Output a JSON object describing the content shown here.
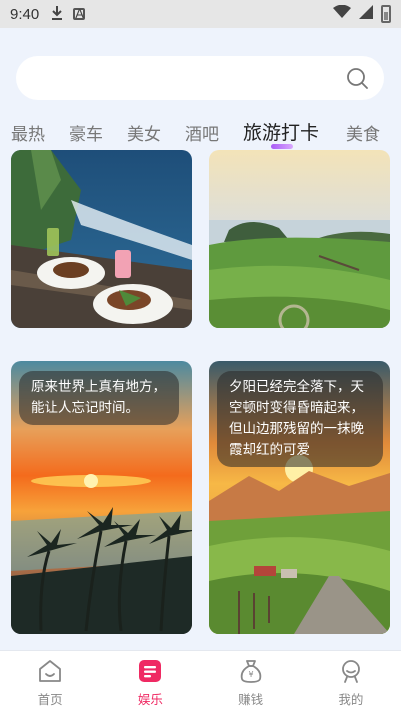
{
  "status_bar": {
    "time": "9:40",
    "icons": [
      "download-icon",
      "keyboard-icon",
      "wifi-icon",
      "signal-icon",
      "battery-icon"
    ]
  },
  "search": {
    "placeholder": ""
  },
  "tabs": [
    {
      "label": "最热"
    },
    {
      "label": "豪车"
    },
    {
      "label": "美女"
    },
    {
      "label": "酒吧"
    },
    {
      "label": "旅游打卡",
      "active": true
    },
    {
      "label": "美食"
    }
  ],
  "cards": [
    {
      "image": "seaside-dinner-photo",
      "caption": ""
    },
    {
      "image": "green-cliff-coast-photo",
      "caption": ""
    },
    {
      "image": "palm-beach-sunset-photo",
      "caption": "原来世界上真有地方，能让人忘记时间。"
    },
    {
      "image": "mountain-valley-sunset-photo",
      "caption": "夕阳已经完全落下，天空顿时变得昏暗起来，但山边那残留的一抹晚霞却红的可爱"
    }
  ],
  "bottom_nav": [
    {
      "label": "首页",
      "icon": "home-icon"
    },
    {
      "label": "娱乐",
      "icon": "entertainment-icon",
      "active": true
    },
    {
      "label": "赚钱",
      "icon": "money-bag-icon"
    },
    {
      "label": "我的",
      "icon": "profile-icon"
    }
  ],
  "colors": {
    "background": "#eef3fc",
    "accent": "#ef2a63",
    "tab_indicator": "#a95cf5"
  }
}
